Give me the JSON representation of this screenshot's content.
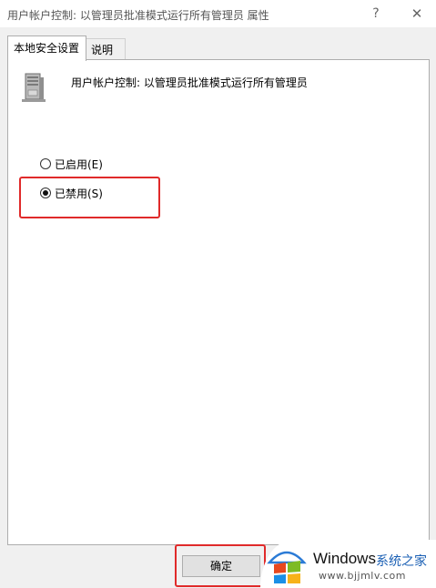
{
  "window": {
    "title": "用户帐户控制: 以管理员批准模式运行所有管理员 属性",
    "help_label": "?",
    "close_label": "✕"
  },
  "tabs": [
    {
      "label": "本地安全设置",
      "selected": true
    },
    {
      "label": "说明",
      "selected": false
    }
  ],
  "policy": {
    "icon": "server-policy-icon",
    "name": "用户帐户控制: 以管理员批准模式运行所有管理员"
  },
  "options": [
    {
      "label": "已启用(E)",
      "checked": false
    },
    {
      "label": "已禁用(S)",
      "checked": true
    }
  ],
  "buttons": {
    "ok_label": "确定"
  },
  "watermark": {
    "brand": "Windows",
    "site": "系统之家",
    "url": "www.bjjmlv.com"
  },
  "colors": {
    "highlight": "#e02a2a",
    "window_bg": "#f0f0f0",
    "panel_bg": "#ffffff"
  }
}
